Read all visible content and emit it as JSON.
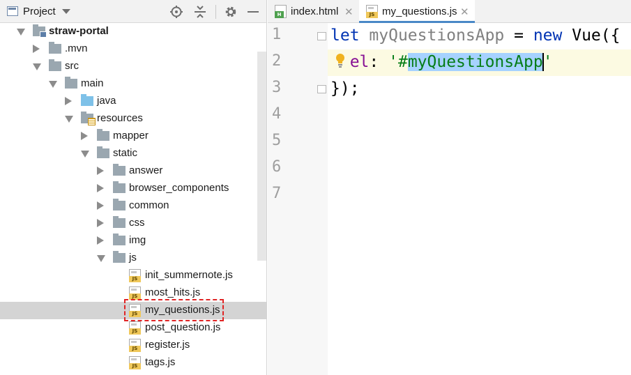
{
  "project_panel": {
    "title": "Project",
    "tree": [
      {
        "label": "straw-portal",
        "depth": 0,
        "expanded": true,
        "kind": "module"
      },
      {
        "label": ".mvn",
        "depth": 1,
        "expanded": false,
        "kind": "folder"
      },
      {
        "label": "src",
        "depth": 1,
        "expanded": true,
        "kind": "folder"
      },
      {
        "label": "main",
        "depth": 2,
        "expanded": true,
        "kind": "folder"
      },
      {
        "label": "java",
        "depth": 3,
        "expanded": false,
        "kind": "source-folder"
      },
      {
        "label": "resources",
        "depth": 3,
        "expanded": true,
        "kind": "resources-folder"
      },
      {
        "label": "mapper",
        "depth": 4,
        "expanded": false,
        "kind": "folder"
      },
      {
        "label": "static",
        "depth": 4,
        "expanded": true,
        "kind": "folder"
      },
      {
        "label": "answer",
        "depth": 5,
        "expanded": false,
        "kind": "folder"
      },
      {
        "label": "browser_components",
        "depth": 5,
        "expanded": false,
        "kind": "folder"
      },
      {
        "label": "common",
        "depth": 5,
        "expanded": false,
        "kind": "folder"
      },
      {
        "label": "css",
        "depth": 5,
        "expanded": false,
        "kind": "folder"
      },
      {
        "label": "img",
        "depth": 5,
        "expanded": false,
        "kind": "folder"
      },
      {
        "label": "js",
        "depth": 5,
        "expanded": true,
        "kind": "folder"
      },
      {
        "label": "init_summernote.js",
        "depth": 6,
        "kind": "js-file"
      },
      {
        "label": "most_hits.js",
        "depth": 6,
        "kind": "js-file"
      },
      {
        "label": "my_questions.js",
        "depth": 6,
        "kind": "js-file",
        "selected": true
      },
      {
        "label": "post_question.js",
        "depth": 6,
        "kind": "js-file"
      },
      {
        "label": "register.js",
        "depth": 6,
        "kind": "js-file"
      },
      {
        "label": "tags.js",
        "depth": 6,
        "kind": "js-file"
      }
    ]
  },
  "editor": {
    "tabs": [
      {
        "label": "index.html",
        "icon": "html-file-icon",
        "active": false
      },
      {
        "label": "my_questions.js",
        "icon": "js-file-icon",
        "active": true
      }
    ],
    "line_numbers": [
      "1",
      "2",
      "3",
      "4",
      "5",
      "6",
      "7"
    ],
    "code": {
      "line1": {
        "kw_let": "let",
        "var_name": "myQuestionsApp",
        "op": " = ",
        "kw_new": "new",
        "rest": " Vue({"
      },
      "line2": {
        "indent": "  ",
        "prop": "el",
        "colon": ": ",
        "quote_open": "'#",
        "selected": "myQuestionsApp",
        "quote_close": "'"
      },
      "line3": {
        "text": "});"
      }
    }
  },
  "colors": {
    "keyword": "#0033b3",
    "string": "#067d17",
    "property": "#871094",
    "selection": "#a6d2ff",
    "annotation_box": "#e02424"
  }
}
